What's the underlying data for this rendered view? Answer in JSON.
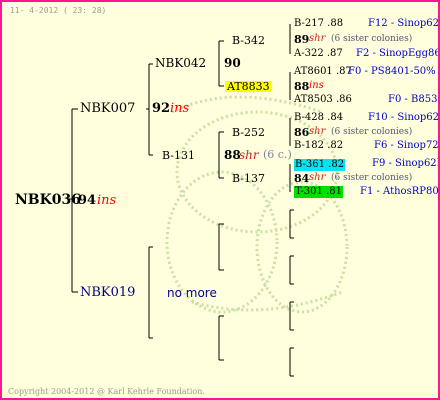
{
  "date": "11- 4-2012 ( 23: 28)",
  "footer": "Copyright 2004-2012 @ Karl Kehrle Foundation.",
  "root": {
    "name": "NBK036",
    "num": "94",
    "suffix": "ins"
  },
  "sire": {
    "name": "NBK007",
    "num": "92",
    "suffix": "ins"
  },
  "dam": {
    "name": "NBK019",
    "note": "no more"
  },
  "g3": {
    "a": {
      "name": "NBK042",
      "num": "90"
    },
    "b": {
      "name": "B-131",
      "num": "88",
      "suffix": "shr",
      "note": "(6 c.)"
    }
  },
  "g4": {
    "a1": {
      "name": "B-342",
      "num": "89",
      "suffix": "shr",
      "note": "(6 sister colonies)",
      "sire": "B-217 .88",
      "sire_line": "F12 - Sinop62R",
      "dam": "A-322 .87",
      "dam_line": "F2 - SinopEgg86R"
    },
    "a2": {
      "name": "AT8833",
      "num": "88",
      "suffix": "ins",
      "sire": "AT8601 .87",
      "sire_line": "F0 - PS8401-50%",
      "dam": "AT8503 .86",
      "dam_line": "F0 - B8537"
    },
    "b1": {
      "name": "B-252",
      "num": "86",
      "suffix": "shr",
      "note": "(6 sister colonies)",
      "sire": "B-428 .84",
      "sire_line": "F10 - Sinop62R",
      "dam": "B-182 .82",
      "dam_line": "F6 - Sinop72R"
    },
    "b2": {
      "name": "B-137",
      "num": "84",
      "suffix": "shr",
      "note": "(6 sister colonies)",
      "sire": "B-361 .82",
      "sire_line": "F9 - Sinop62R",
      "dam": "T-301 .81",
      "dam_line": "F1 - AthosRP80R"
    }
  }
}
